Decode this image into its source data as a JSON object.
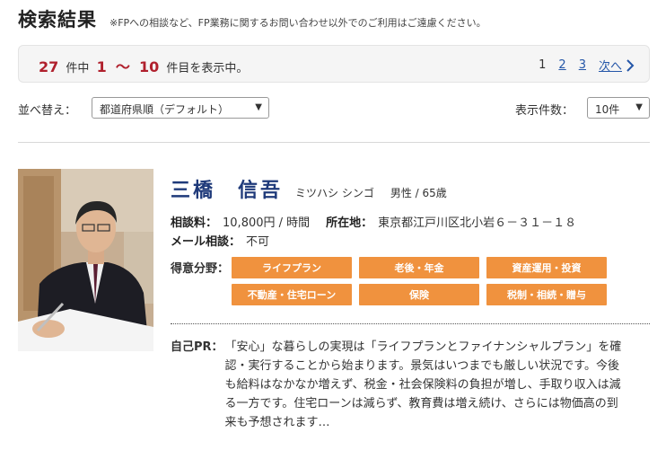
{
  "header": {
    "title": "検索結果",
    "notice": "※FPへの相談など、FP業務に関するお問い合わせ以外でのご利用はご遠慮ください。"
  },
  "result_bar": {
    "total": "27",
    "total_unit": "件中",
    "range_start": "1",
    "range_sep": "〜",
    "range_end": "10",
    "range_suffix": "件目を表示中。",
    "pages": [
      "1",
      "2",
      "3"
    ],
    "next_label": "次へ"
  },
  "sort": {
    "label": "並べ替え：",
    "selected": "都道府県順（デフォルト）",
    "perpage_label": "表示件数：",
    "perpage_selected": "10件"
  },
  "result": {
    "name": "三橋　信吾",
    "kana": "ミツハシ シンゴ",
    "gender_age": "男性 / 65歳",
    "fee_label": "相談料：",
    "fee_value": "10,800円 / 時間",
    "location_label": "所在地：",
    "location_value": "東京都江戸川区北小岩６－３１－１８",
    "mail_label": "メール相談：",
    "mail_value": "不可",
    "specialty_label": "得意分野：",
    "specialties": [
      "ライフプラン",
      "老後・年金",
      "資産運用・投資",
      "不動産・住宅ローン",
      "保険",
      "税制・相続・贈与"
    ],
    "pr_label": "自己PR：",
    "pr_text": "「安心」な暮らしの実現は「ライフプランとファイナンシャルプラン」を確認・実行することから始まります。景気はいつまでも厳しい状況です。今後も給料はなかなか増えず、税金・社会保険料の負担が増し、手取り収入は減る一方です。住宅ローンは減らず、教育費は増え続け、さらには物価高の到来も予想されます…"
  },
  "colors": {
    "accent_red": "#b0202d",
    "name_blue": "#1f3a7a",
    "tag_orange": "#f0923e",
    "link_blue": "#2456a8"
  }
}
